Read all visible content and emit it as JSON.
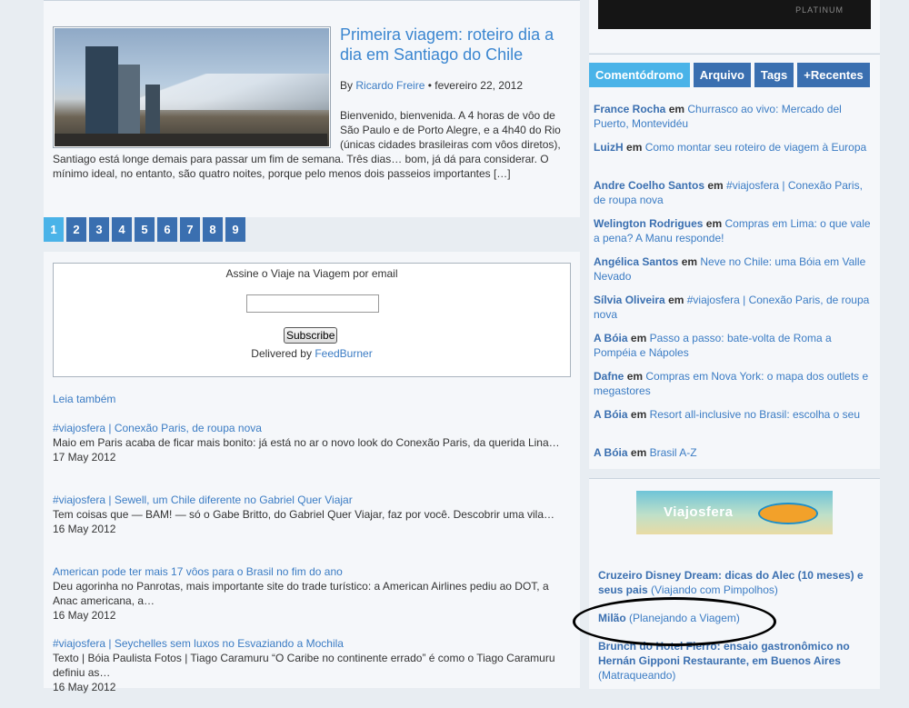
{
  "post": {
    "title": "Primeira viagem: roteiro dia a dia em Santiago do Chile",
    "by": "By",
    "author": "Ricardo Freire",
    "date": "• fevereiro 22, 2012",
    "excerpt": "Bienvenido, bienvenida. A 4 horas de vôo de São Paulo e de Porto Alegre, e a 4h40 do Rio (únicas cidades brasileiras com vôos diretos), Santiago está longe demais para passar um fim de semana. Três dias… bom, já dá para considerar. O mínimo ideal, no entanto, são quatro noites, porque pelo menos dois passeios importantes […]"
  },
  "pagination": [
    "1",
    "2",
    "3",
    "4",
    "5",
    "6",
    "7",
    "8",
    "9"
  ],
  "subscribe": {
    "title": "Assine o Viaje na Viagem por email",
    "button": "Subscribe",
    "delivered_by": "Delivered by",
    "feedburner": "FeedBurner"
  },
  "related": {
    "heading": "Leia também",
    "items": [
      {
        "title": "#viajosfera | Conexão Paris, de roupa nova",
        "text": "Maio em Paris acaba de ficar mais bonito: já está no ar o novo look do Conexão Paris, da querida Lina…",
        "date": "17 May 2012"
      },
      {
        "title": "#viajosfera | Sewell, um Chile diferente no Gabriel Quer Viajar",
        "text": "Tem coisas que — BAM! — só o Gabe Britto, do Gabriel Quer Viajar, faz por você. Descobrir uma vila…",
        "date": "16 May 2012"
      },
      {
        "title": "American pode ter mais 17 vôos para o Brasil no fim do ano",
        "text": "Deu agorinha no Panrotas, mais importante site do trade turístico: a American Airlines pediu ao DOT, a Anac americana, a…",
        "date": "16 May 2012"
      },
      {
        "title": "#viajosfera | Seychelles sem luxos no Esvaziando a Mochila",
        "text": "Texto | Bóia Paulista Fotos | Tiago Caramuru “O Caribe no continente errado” é como o Tiago Caramuru definiu as…",
        "date": "16 May 2012"
      }
    ]
  },
  "ad": {
    "text": "PLATINUM"
  },
  "tabs": [
    "Comentódromo",
    "Arquivo",
    "Tags",
    "+Recentes"
  ],
  "comments": [
    {
      "user": "France Rocha",
      "em": "em",
      "post": "Churrasco ao vivo: Mercado del Puerto, Montevidéu"
    },
    {
      "user": "LuizH",
      "em": "em",
      "post": "Como montar seu roteiro de viagem à Europa"
    },
    {
      "user": "Andre Coelho Santos",
      "em": "em",
      "post": "#viajosfera | Conexão Paris, de roupa nova"
    },
    {
      "user": "Welington Rodrigues",
      "em": "em",
      "post": "Compras em Lima: o que vale a pena? A Manu responde!"
    },
    {
      "user": "Angélica Santos",
      "em": "em",
      "post": "Neve no Chile: uma Bóia em Valle Nevado"
    },
    {
      "user": "Sílvia Oliveira",
      "em": "em",
      "post": "#viajosfera | Conexão Paris, de roupa nova"
    },
    {
      "user": "A Bóia",
      "em": "em",
      "post": "Passo a passo: bate-volta de Roma a Pompéia e Nápoles"
    },
    {
      "user": "Dafne",
      "em": "em",
      "post": "Compras em Nova York: o mapa dos outlets e megastores"
    },
    {
      "user": "A Bóia",
      "em": "em",
      "post": "Resort all-inclusive no Brasil: escolha o seu"
    },
    {
      "user": "A Bóia",
      "em": "em",
      "post": "Brasil A-Z"
    }
  ],
  "viajosfera": {
    "banner": "Viajosfera",
    "items": [
      {
        "title": "Cruzeiro Disney Dream: dicas do Alec (10 meses) e seus pais",
        "source": "(Viajando com Pimpolhos)"
      },
      {
        "title": "Milão",
        "source": "(Planejando a Viagem)"
      },
      {
        "title": "Brunch do Hotel Fierro: ensaio gastronômico no Hernán Gipponi Restaurante, em Buenos Aires",
        "source": "(Matraqueando)"
      }
    ]
  }
}
